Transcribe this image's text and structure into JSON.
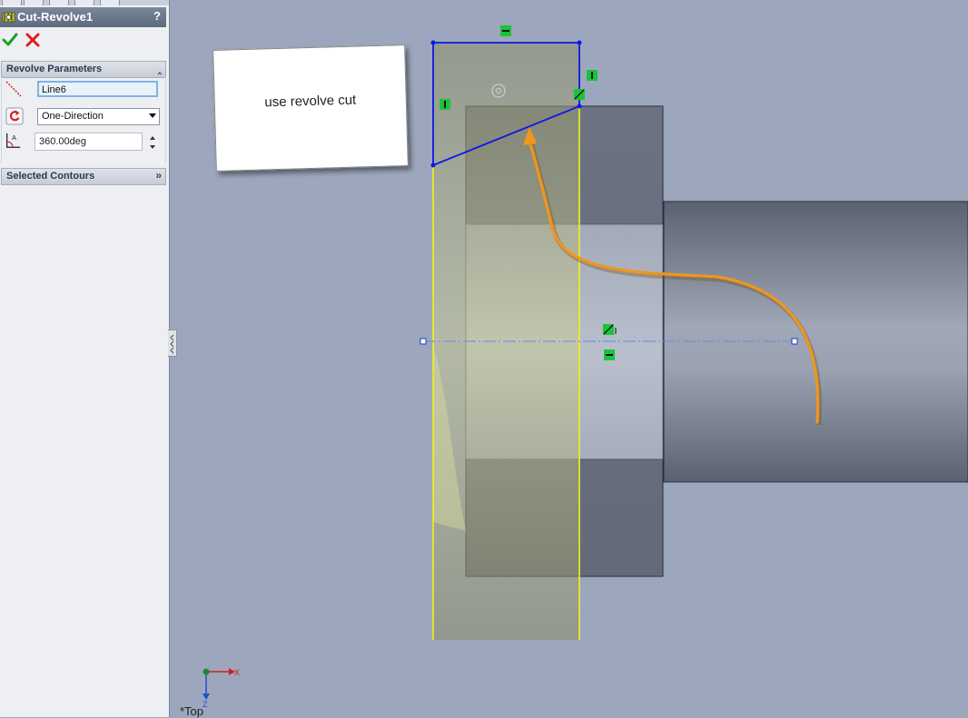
{
  "feature_manager": {
    "title": "Cut-Revolve1",
    "help_label": "?",
    "ok_icon": "green-check-icon",
    "cancel_icon": "red-x-icon"
  },
  "revolve_parameters": {
    "header": "Revolve Parameters",
    "axis_value": "Line6",
    "direction_value": "One-Direction",
    "angle_value": "360.00deg"
  },
  "selected_contours": {
    "header": "Selected Contours"
  },
  "annotation": {
    "text": "use revolve cut"
  },
  "triad": {
    "x_label": "X",
    "z_label": "Z"
  },
  "view": {
    "label": "*Top"
  },
  "colors": {
    "background": "#9ca7bd",
    "sketch_blue": "#0a18e6",
    "yellow_edge": "#f2f21a",
    "relation_green": "#19c43a",
    "arrow_orange": "#f0961c"
  }
}
